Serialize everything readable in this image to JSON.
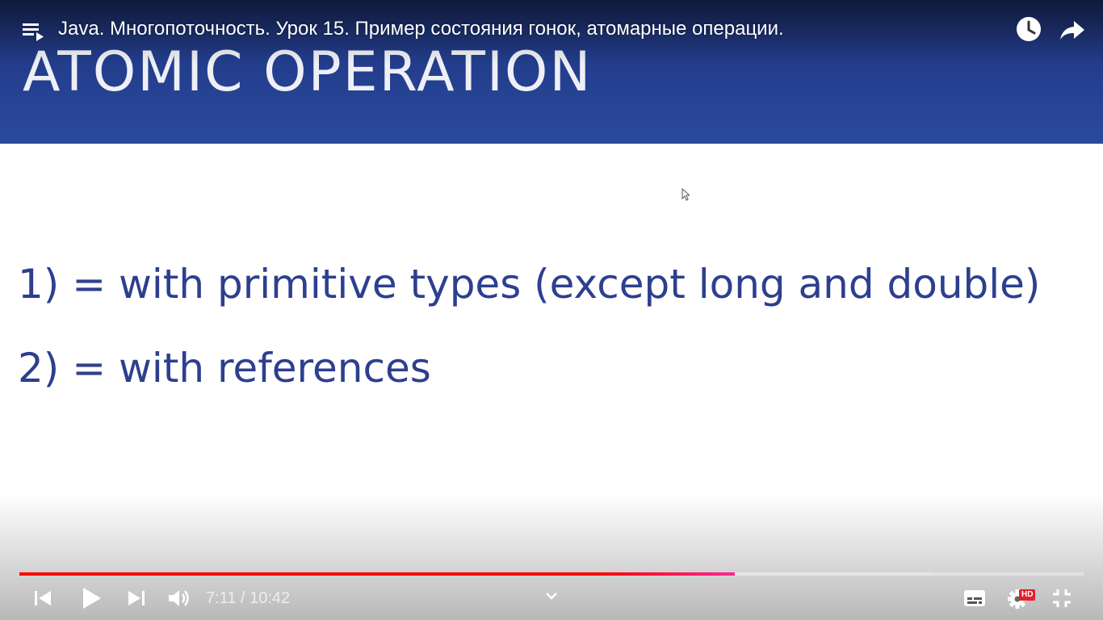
{
  "slide": {
    "title": "ATOMIC OPERATION",
    "bullets": [
      "1) = with primitive types (except long and double)",
      "2) = with references"
    ]
  },
  "player": {
    "video_title": "Java. Многопоточность. Урок 15. Пример состояния гонок, атомарные операции.",
    "time_display": "7:11 / 10:42",
    "progress": {
      "played_fraction": 0.672,
      "buffered_fraction": 0.856
    },
    "quality_badge": "HD",
    "colors": {
      "progress_played": "#ff0000",
      "progress_end": "#ff2791",
      "slide_header": "#2b4a9e",
      "slide_text": "#2d3f8e"
    },
    "icons": {
      "playlist": "playlist-icon",
      "watch_later": "clock-icon",
      "share": "share-arrow-icon",
      "previous": "skip-previous-icon",
      "play": "play-icon",
      "next": "skip-next-icon",
      "volume": "volume-icon",
      "chapters": "chevron-down-icon",
      "subtitles": "subtitles-icon",
      "settings": "gear-icon",
      "fullscreen": "exit-fullscreen-icon"
    }
  }
}
